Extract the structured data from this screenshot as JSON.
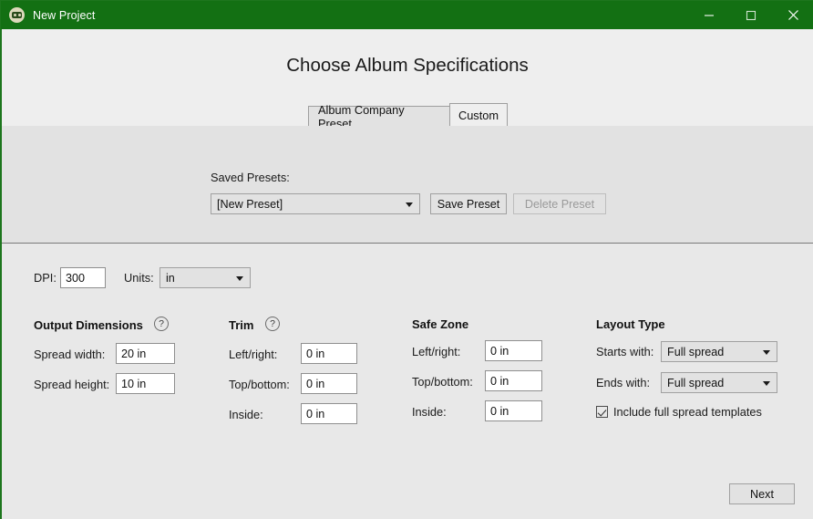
{
  "window": {
    "title": "New Project",
    "icon": "album-app-icon",
    "accent_green": "#137013",
    "controls": {
      "minimize": "minimize-icon",
      "maximize": "maximize-icon",
      "close": "close-icon"
    }
  },
  "header": {
    "page_title": "Choose Album Specifications"
  },
  "tabs": [
    {
      "label": "Album Company Preset",
      "active": false
    },
    {
      "label": "Custom",
      "active": true
    }
  ],
  "presets": {
    "label": "Saved Presets:",
    "selected": "[New Preset]",
    "save_label": "Save Preset",
    "delete_label": "Delete Preset",
    "delete_enabled": false
  },
  "settings": {
    "dpi_label": "DPI:",
    "dpi_value": "300",
    "units_label": "Units:",
    "units_value": "in"
  },
  "output_dimensions": {
    "heading": "Output Dimensions",
    "help": "?",
    "spread_width_label": "Spread width:",
    "spread_width_value": "20 in",
    "spread_height_label": "Spread height:",
    "spread_height_value": "10 in"
  },
  "trim": {
    "heading": "Trim",
    "help": "?",
    "left_right_label": "Left/right:",
    "left_right_value": "0 in",
    "top_bottom_label": "Top/bottom:",
    "top_bottom_value": "0 in",
    "inside_label": "Inside:",
    "inside_value": "0 in"
  },
  "safe_zone": {
    "heading": "Safe Zone",
    "left_right_label": "Left/right:",
    "left_right_value": "0 in",
    "top_bottom_label": "Top/bottom:",
    "top_bottom_value": "0 in",
    "inside_label": "Inside:",
    "inside_value": "0 in"
  },
  "layout_type": {
    "heading": "Layout Type",
    "starts_with_label": "Starts with:",
    "starts_with_value": "Full spread",
    "ends_with_label": "Ends with:",
    "ends_with_value": "Full spread",
    "include_templates_label": "Include full spread templates",
    "include_templates_checked": true
  },
  "footer": {
    "next_label": "Next"
  }
}
